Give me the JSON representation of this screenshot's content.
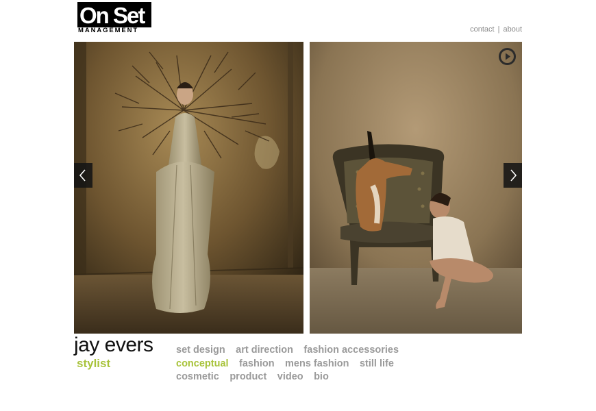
{
  "logo": {
    "main": "On Set",
    "sub": "MANAGEMENT"
  },
  "topnav": {
    "contact": "contact",
    "separator": "|",
    "about": "about"
  },
  "photos": {
    "left": {
      "icon": "photo-woman-branches"
    },
    "right": {
      "icon": "photo-woman-chair-antelope"
    }
  },
  "controls": {
    "prev_icon": "chevron-left-icon",
    "next_icon": "chevron-right-icon",
    "play_icon": "play-icon"
  },
  "artist": {
    "name": "jay evers",
    "role": "stylist"
  },
  "categories": {
    "row1": [
      "set design",
      "art direction",
      "fashion accessories"
    ],
    "row2": [
      "conceptual",
      "fashion",
      "mens fashion",
      "still life"
    ],
    "row3": [
      "cosmetic",
      "product",
      "video",
      "bio"
    ],
    "active": "conceptual"
  },
  "colors": {
    "accent": "#a8c33a",
    "link": "#9a9a9a",
    "nav": "#8a8a8a"
  }
}
